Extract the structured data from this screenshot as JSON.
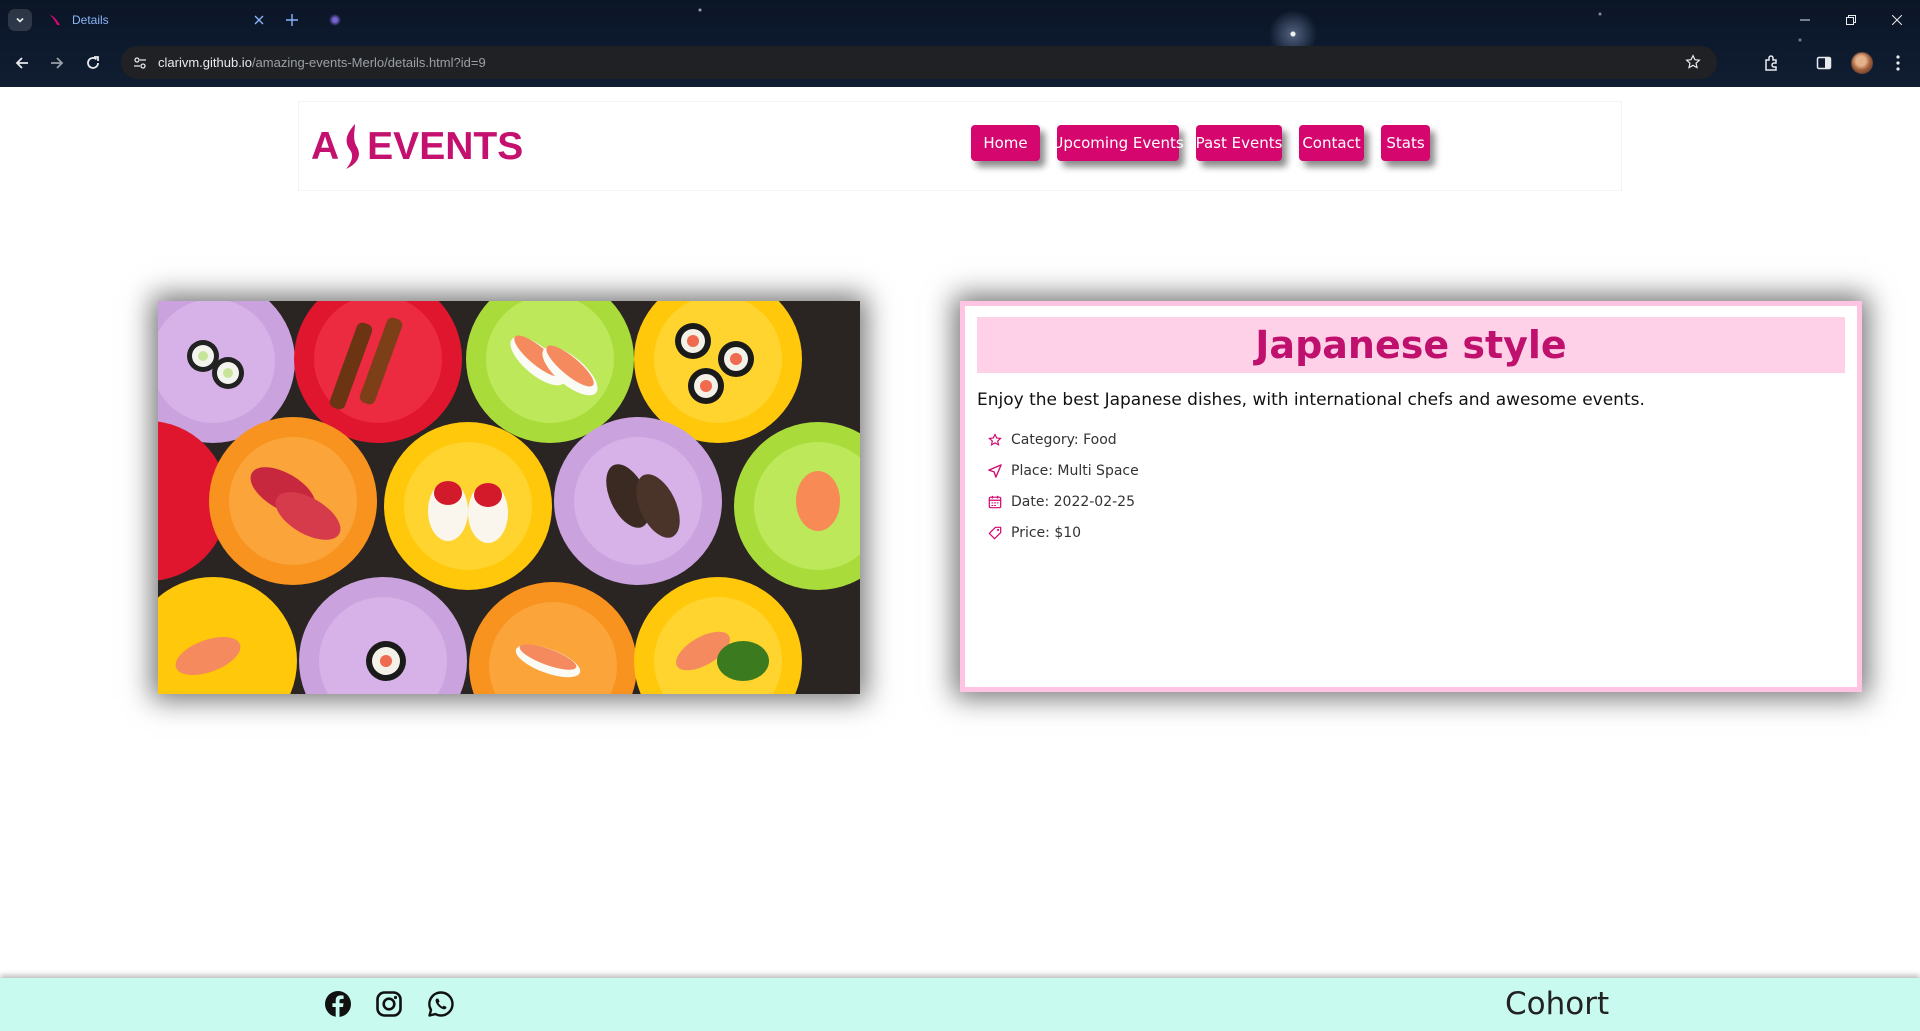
{
  "browser": {
    "tab_title": "Details",
    "url_host": "clarivm.github.io",
    "url_path": "/amazing-events-Merlo/details.html?id=9",
    "icons": [
      "tab-search-icon",
      "close-icon",
      "plus-icon",
      "minimize-icon",
      "restore-icon",
      "close-window-icon",
      "back-arrow-icon",
      "forward-arrow-icon",
      "reload-icon",
      "site-info-icon",
      "star-icon",
      "extensions-icon",
      "side-panel-icon",
      "profile-avatar",
      "kebab-menu-icon"
    ]
  },
  "header": {
    "logo_letter_a": "A",
    "logo_text": "EVENTS",
    "nav": [
      {
        "label": "Home"
      },
      {
        "label": "Upcoming Events"
      },
      {
        "label": "Past Events"
      },
      {
        "label": "Contact"
      },
      {
        "label": "Stats"
      }
    ]
  },
  "event": {
    "image_subject": "sushi on colorful plates",
    "title": "Japanese style",
    "description": "Enjoy the best Japanese dishes, with international chefs and awesome events.",
    "category": "Category: Food",
    "place": "Place: Multi Space",
    "date": "Date: 2022-02-25",
    "price": "Price: $10"
  },
  "footer": {
    "social": [
      "facebook-icon",
      "instagram-icon",
      "whatsapp-icon"
    ],
    "cohort": "Cohort"
  },
  "colors": {
    "brand": "#d6066f",
    "title_bg": "#ffd1e8",
    "card_border": "#ffc4e2",
    "footer_bg": "#c8faef"
  }
}
